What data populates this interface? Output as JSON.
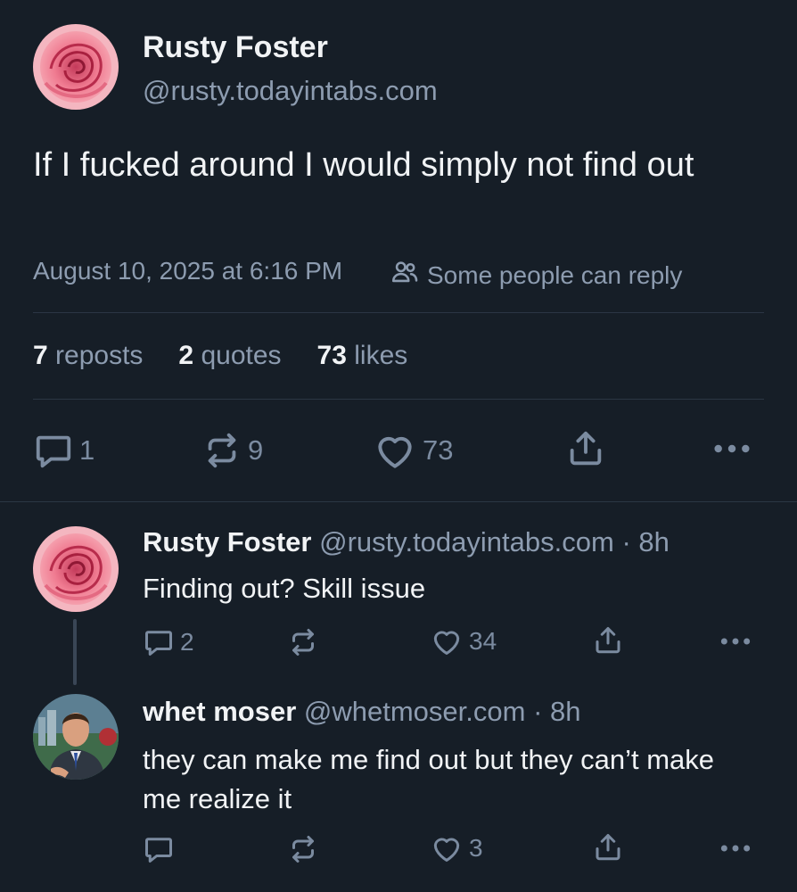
{
  "main_post": {
    "author_name": "Rusty Foster",
    "author_handle": "@rusty.todayintabs.com",
    "text": "If I fucked around I would simply not find out",
    "timestamp": "August 10, 2025 at 6:16 PM",
    "reply_setting": "Some people can reply",
    "stats": {
      "reposts_count": "7",
      "reposts_label": "reposts",
      "quotes_count": "2",
      "quotes_label": "quotes",
      "likes_count": "73",
      "likes_label": "likes"
    },
    "actions": {
      "reply_count": "1",
      "repost_count": "9",
      "like_count": "73"
    }
  },
  "replies": [
    {
      "author_name": "Rusty Foster",
      "author_handle": "@rusty.todayintabs.com",
      "time": "· 8h",
      "text": "Finding out? Skill issue",
      "reply_count": "2",
      "repost_count": "",
      "like_count": "34"
    },
    {
      "author_name": "whet moser",
      "author_handle": "@whetmoser.com",
      "time": "· 8h",
      "text": "they can make me find out but they can’t make me realize it",
      "reply_count": "",
      "repost_count": "",
      "like_count": "3"
    }
  ],
  "icons": {
    "reply": "speech-bubble-icon",
    "repost": "repost-arrows-icon",
    "like": "heart-icon",
    "share": "share-icon",
    "more": "more-dots-icon",
    "reply_setting": "people-icon"
  },
  "colors": {
    "background": "#161e27",
    "text": "#f1f3f5",
    "muted": "#8d9cb0",
    "icon": "#7b8ba0",
    "divider": "#2b3644"
  }
}
